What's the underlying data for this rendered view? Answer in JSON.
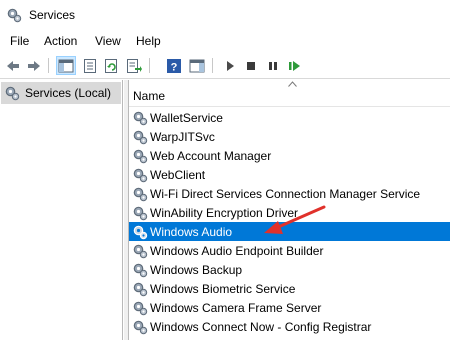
{
  "window": {
    "title": "Services"
  },
  "menu": {
    "items": [
      "File",
      "Action",
      "View",
      "Help"
    ]
  },
  "toolbar": {
    "buttons": [
      "back-icon",
      "forward-icon",
      "show-hide-tree-icon",
      "properties-icon",
      "refresh-icon",
      "export-list-icon",
      "help-icon",
      "action-pane-icon",
      "start-service-icon",
      "stop-service-icon",
      "pause-service-icon",
      "restart-service-icon"
    ]
  },
  "tree": {
    "root_label": "Services (Local)"
  },
  "table": {
    "column_name": "Name",
    "rows": [
      {
        "name": "WalletService",
        "selected": false
      },
      {
        "name": "WarpJITSvc",
        "selected": false
      },
      {
        "name": "Web Account Manager",
        "selected": false
      },
      {
        "name": "WebClient",
        "selected": false
      },
      {
        "name": "Wi-Fi Direct Services Connection Manager Service",
        "selected": false
      },
      {
        "name": "WinAbility Encryption Driver",
        "selected": false
      },
      {
        "name": "Windows Audio",
        "selected": true
      },
      {
        "name": "Windows Audio Endpoint Builder",
        "selected": false
      },
      {
        "name": "Windows Backup",
        "selected": false
      },
      {
        "name": "Windows Biometric Service",
        "selected": false
      },
      {
        "name": "Windows Camera Frame Server",
        "selected": false
      },
      {
        "name": "Windows Connect Now - Config Registrar",
        "selected": false
      }
    ]
  },
  "colors": {
    "selection": "#0078d7",
    "annotation_arrow": "#e0312b",
    "toolbar_active": "#cce8ff"
  }
}
